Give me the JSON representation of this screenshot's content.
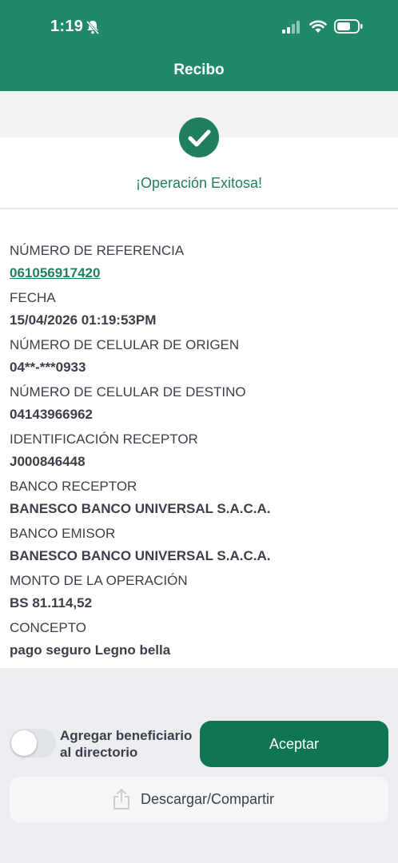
{
  "status_bar": {
    "time": "1:19"
  },
  "header": {
    "title": "Recibo"
  },
  "success": {
    "message": "¡Operación Exitosa!"
  },
  "details": [
    {
      "label": "NÚMERO DE REFERENCIA",
      "value": "061056917420"
    },
    {
      "label": "FECHA",
      "value": "15/04/2026 01:19:53PM"
    },
    {
      "label": "NÚMERO DE CELULAR DE ORIGEN",
      "value": "04**-***0933"
    },
    {
      "label": "NÚMERO DE CELULAR DE DESTINO",
      "value": "04143966962"
    },
    {
      "label": "IDENTIFICACIÓN RECEPTOR",
      "value": "J000846448"
    },
    {
      "label": "BANCO RECEPTOR",
      "value": "BANESCO BANCO UNIVERSAL S.A.C.A."
    },
    {
      "label": "BANCO EMISOR",
      "value": "BANESCO BANCO UNIVERSAL S.A.C.A."
    },
    {
      "label": "MONTO DE LA OPERACIÓN",
      "value": "BS 81.114,52"
    },
    {
      "label": "CONCEPTO",
      "value": "pago seguro Legno bella"
    }
  ],
  "footer": {
    "toggle_label_line1": "Agregar beneficiario",
    "toggle_label_line2": "al directorio",
    "toggle_on": false,
    "accept_label": "Aceptar",
    "download_label": "Descargar/Compartir"
  },
  "colors": {
    "brand": "#21896a",
    "accent": "#1f7f5f",
    "button": "#0f7651"
  }
}
